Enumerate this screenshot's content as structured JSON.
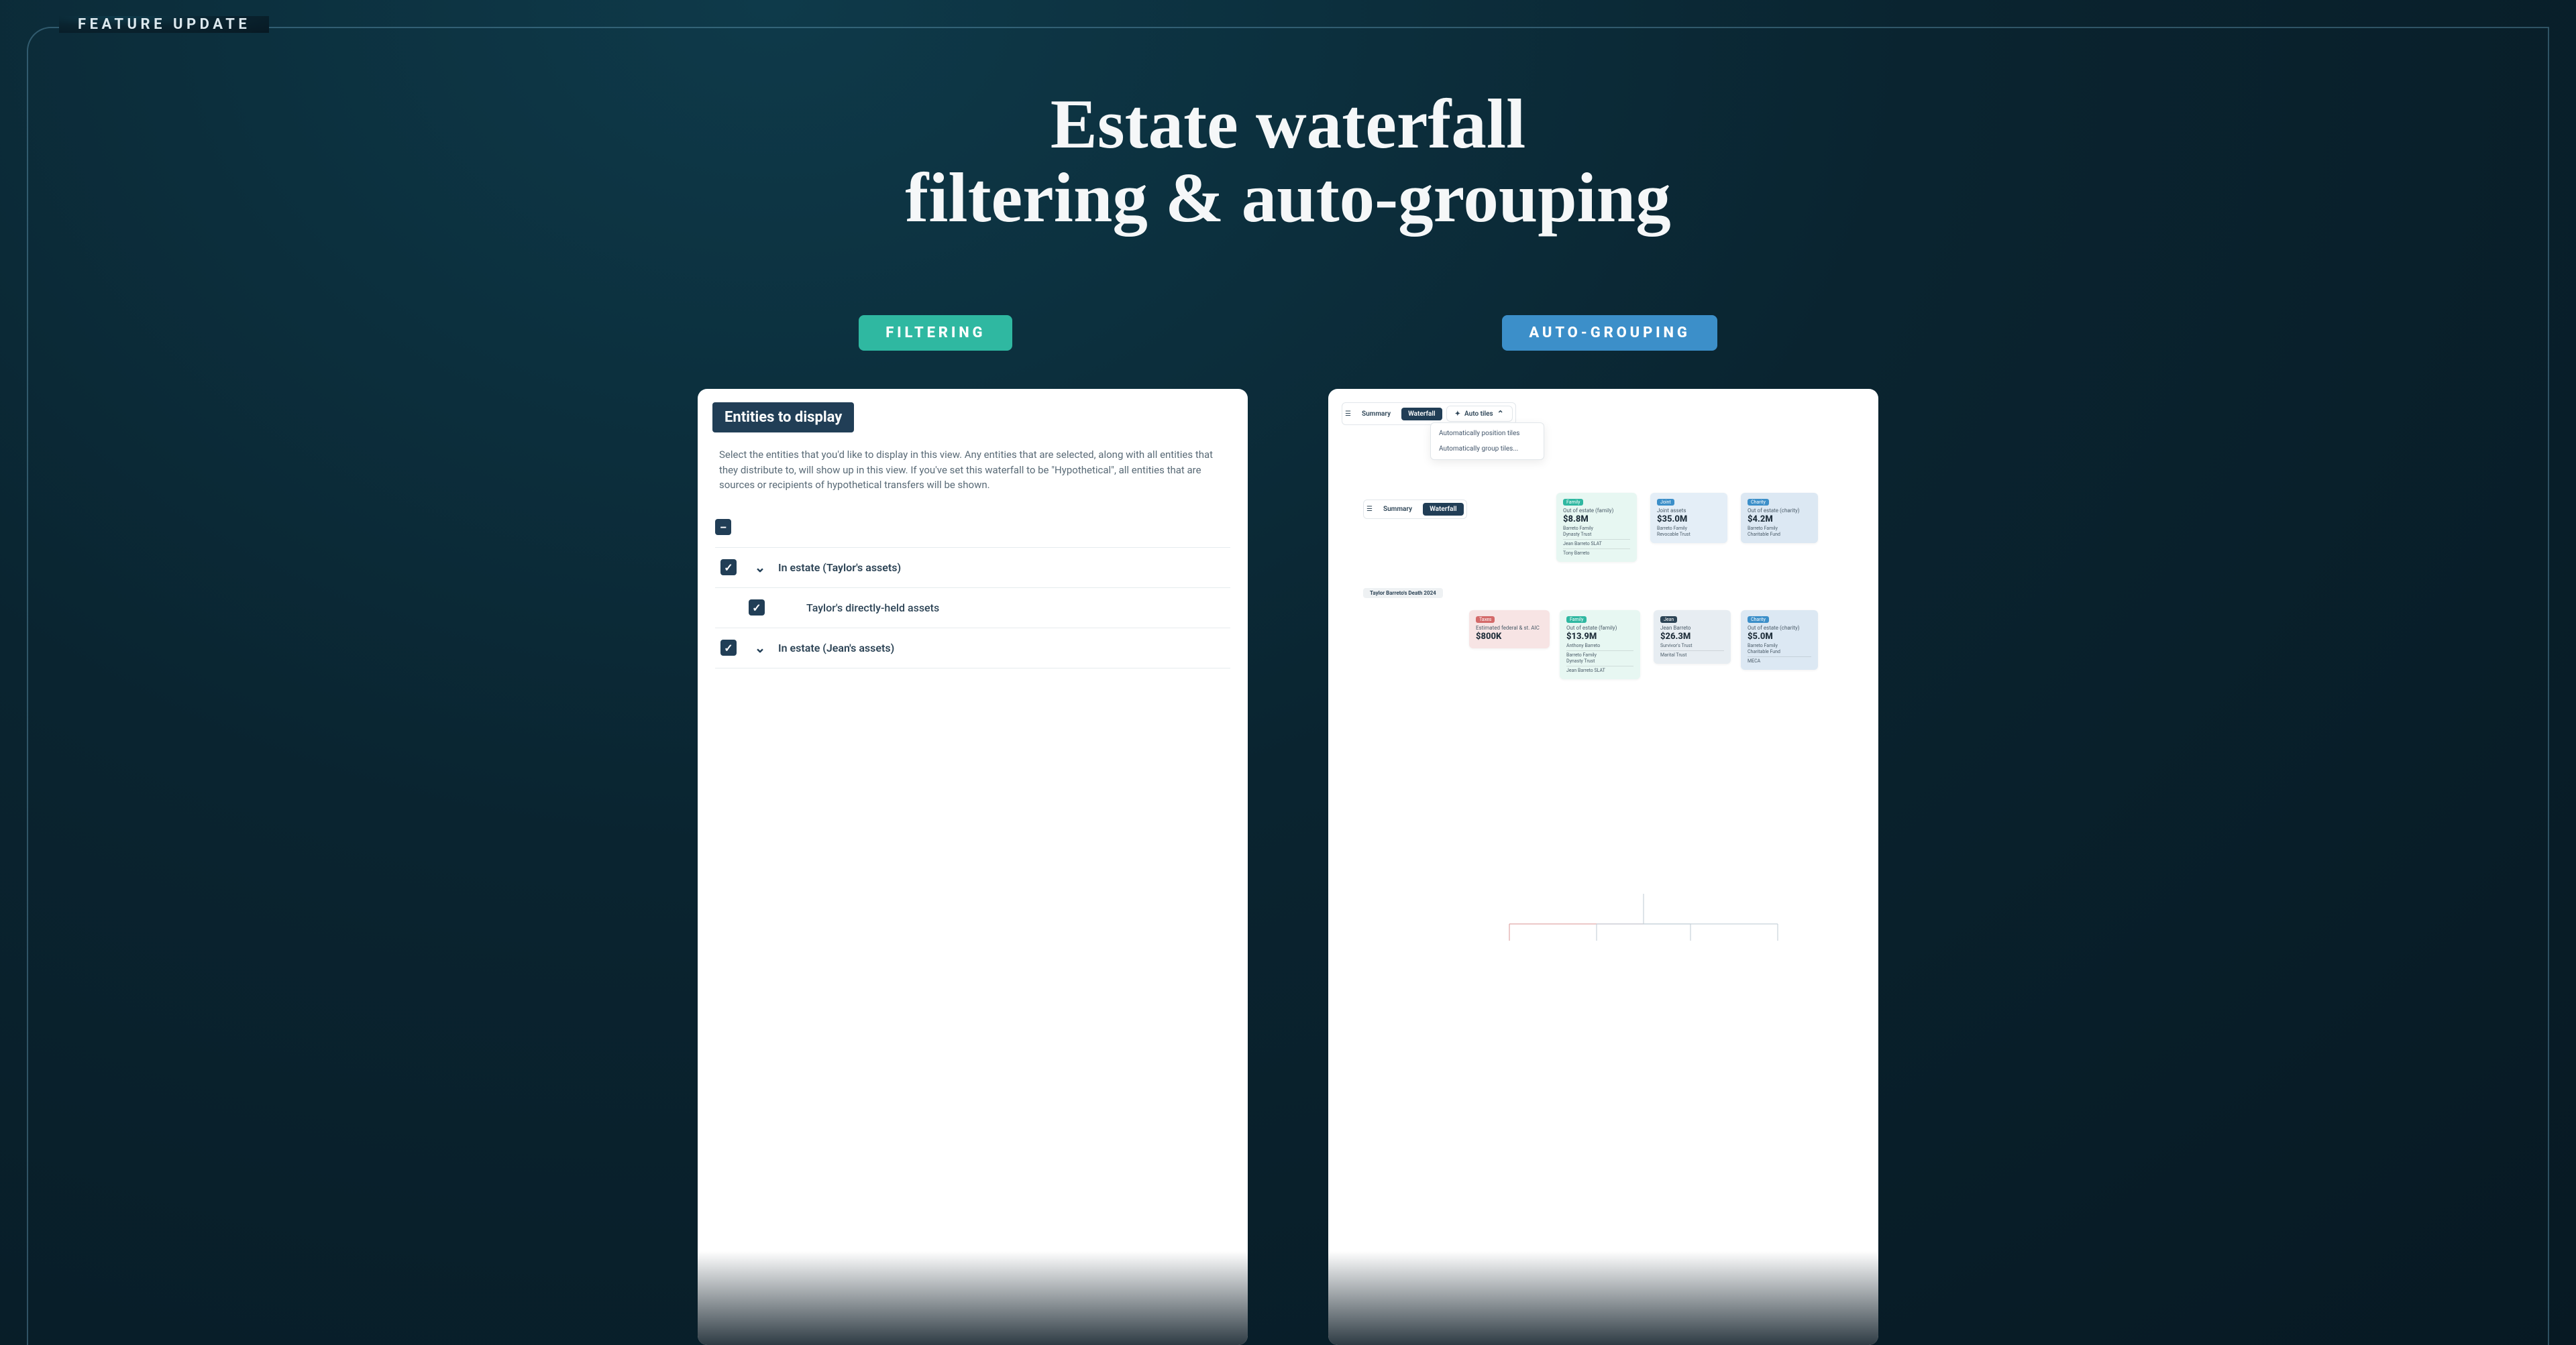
{
  "badge": "FEATURE UPDATE",
  "hero_line1": "Estate waterfall",
  "hero_line2": "filtering & auto-grouping",
  "chip_filtering": "FILTERING",
  "chip_autogroup": "AUTO-GROUPING",
  "filter": {
    "title": "Entities to display",
    "description": "Select the entities that you'd like to display in this view. Any entities that are selected, along with all entities that they distribute to, will show up in this view. If you've set this waterfall to be \"Hypothetical\", all entities that are sources or recipients of hypothetical transfers will be shown.",
    "row_in_estate_taylor": "In estate (Taylor's assets)",
    "row_taylor_direct": "Taylor's directly-held assets",
    "row_in_estate_jean": "In estate (Jean's assets)"
  },
  "auto": {
    "tab_summary": "Summary",
    "tab_waterfall": "Waterfall",
    "btn_auto_tiles": "Auto tiles",
    "menu_pos": "Automatically position tiles",
    "menu_grp": "Automatically group tiles...",
    "death_label": "Taylor Barreto's Death 2024",
    "top_family": {
      "tag": "Family",
      "t1": "Out of estate (family)",
      "val": "$8.8M",
      "l1": "Barreto Family",
      "l2": "Dynasty Trust",
      "l3": "Jean Barreto SLAT",
      "l4": "Tony Barreto"
    },
    "top_joint": {
      "tag": "Joint",
      "t1": "Joint assets",
      "val": "$35.0M",
      "l1": "Barreto Family",
      "l2": "Revocable Trust"
    },
    "top_char": {
      "tag": "Charity",
      "t1": "Out of estate (charity)",
      "val": "$4.2M",
      "l1": "Barreto Family",
      "l2": "Charitable Fund"
    },
    "bot_tax": {
      "tag": "Taxes",
      "t1": "Estimated federal & st. AIC",
      "val": "$800K"
    },
    "bot_family": {
      "tag": "Family",
      "t1": "Out of estate (family)",
      "val": "$13.9M",
      "l1": "Anthony Barreto",
      "l2": "Barreto Family",
      "l3": "Dynasty Trust",
      "l4": "Jean Barreto SLAT"
    },
    "bot_jean": {
      "tag": "Jean",
      "t1": "Jean Barreto",
      "val": "$26.3M",
      "l1": "Survivor's Trust",
      "l2": "Marital Trust"
    },
    "bot_char": {
      "tag": "Charity",
      "t1": "Out of estate (charity)",
      "val": "$5.0M",
      "l1": "Barreto Family",
      "l2": "Charitable Fund",
      "l3": "MECA"
    }
  }
}
